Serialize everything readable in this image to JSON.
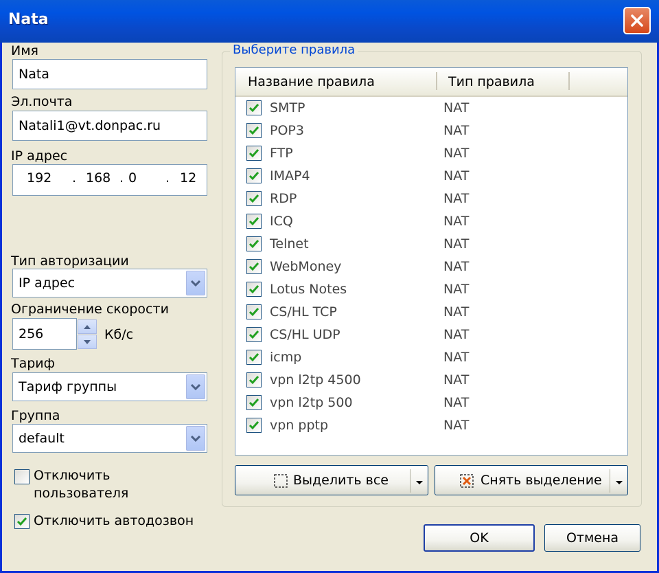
{
  "window": {
    "title": "Nata"
  },
  "form": {
    "name_label": "Имя",
    "name_value": "Nata",
    "email_label": "Эл.почта",
    "email_value": "Natali1@vt.donpac.ru",
    "ip_label": "IP адрес",
    "ip_octets": [
      "192",
      "168",
      "0",
      "12"
    ],
    "ip_dot": ".",
    "auth_label": "Тип авторизации",
    "auth_value": "IP адрес",
    "speed_label": "Ограничение скорости",
    "speed_value": "256",
    "speed_unit": "Кб/с",
    "tariff_label": "Тариф",
    "tariff_value": "Тариф группы",
    "group_label": "Группа",
    "group_value": "default",
    "disable_user_line1": "Отключить",
    "disable_user_line2": "пользователя",
    "disable_user_checked": false,
    "disable_autodial_label": "Отключить автодозвон",
    "disable_autodial_checked": true
  },
  "rules": {
    "group_title": "Выберите правила",
    "col_name": "Название правила",
    "col_type": "Тип правила",
    "items": [
      {
        "name": "SMTP",
        "type": "NAT",
        "checked": true
      },
      {
        "name": "POP3",
        "type": "NAT",
        "checked": true
      },
      {
        "name": "FTP",
        "type": "NAT",
        "checked": true
      },
      {
        "name": "IMAP4",
        "type": "NAT",
        "checked": true
      },
      {
        "name": "RDP",
        "type": "NAT",
        "checked": true
      },
      {
        "name": "ICQ",
        "type": "NAT",
        "checked": true
      },
      {
        "name": "Telnet",
        "type": "NAT",
        "checked": true
      },
      {
        "name": "WebMoney",
        "type": "NAT",
        "checked": true
      },
      {
        "name": "Lotus Notes",
        "type": "NAT",
        "checked": true
      },
      {
        "name": "CS/HL TCP",
        "type": "NAT",
        "checked": true
      },
      {
        "name": "CS/HL UDP",
        "type": "NAT",
        "checked": true
      },
      {
        "name": "icmp",
        "type": "NAT",
        "checked": true
      },
      {
        "name": "vpn l2tp 4500",
        "type": "NAT",
        "checked": true
      },
      {
        "name": "vpn l2tp 500",
        "type": "NAT",
        "checked": true
      },
      {
        "name": "vpn pptp",
        "type": "NAT",
        "checked": true
      }
    ],
    "select_all_label": "Выделить все",
    "deselect_label": "Снять выделение"
  },
  "buttons": {
    "ok": "OK",
    "cancel": "Отмена"
  },
  "colors": {
    "titlebar": "#0053e1",
    "checkmark": "#21a121",
    "close": "#d6481b",
    "group_title": "#0046d5"
  },
  "icons": [
    "close-icon",
    "chevron-down-icon",
    "spin-up-icon",
    "spin-down-icon",
    "checkmark-icon",
    "select-all-icon",
    "deselect-icon"
  ]
}
